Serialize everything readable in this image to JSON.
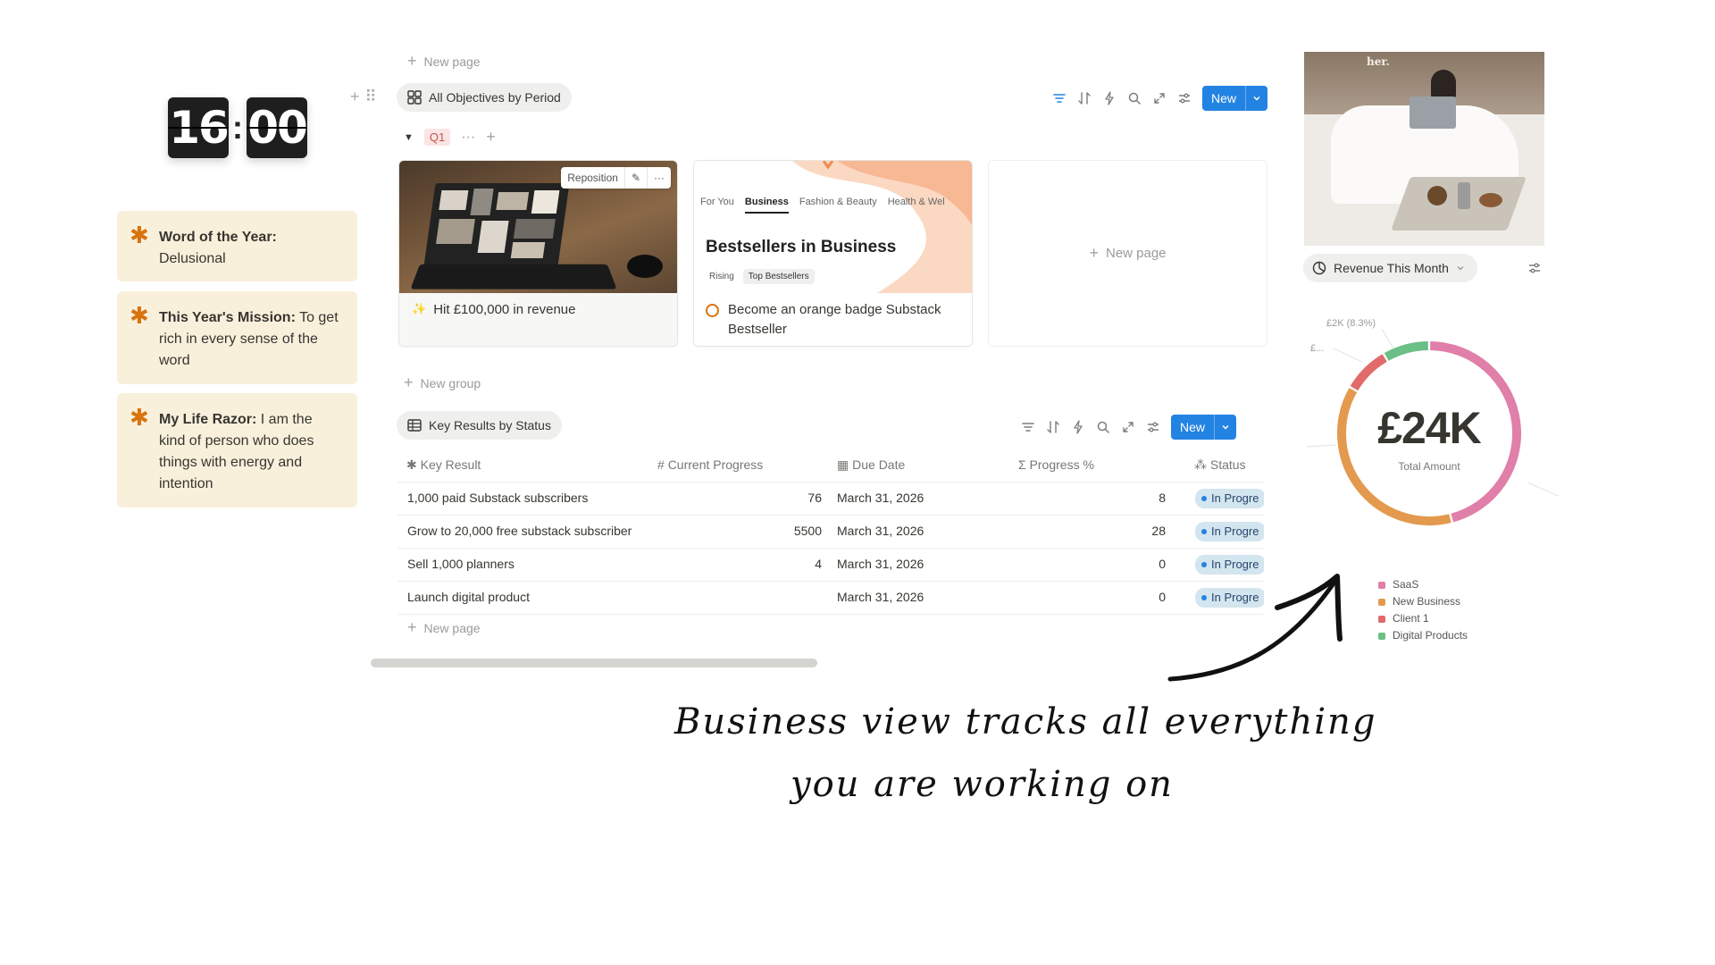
{
  "clock": {
    "hours": "16",
    "minutes": "00",
    "separator": ":"
  },
  "callouts": [
    {
      "bold": "Word of the Year:",
      "text": " Delusional"
    },
    {
      "bold": "This Year's Mission:",
      "text": " To get rich in every sense of the word"
    },
    {
      "bold": "My Life Razor:",
      "text": " I am the kind of person who does things with energy and intention"
    }
  ],
  "objectives": {
    "new_page_top": "New page",
    "view_label": "All Objectives by Period",
    "new_button": "New",
    "group_label": "Q1",
    "cards": [
      {
        "title": "Hit £100,000 in revenue",
        "reposition": "Reposition"
      },
      {
        "title": "Become an orange badge Substack Bestseller",
        "cover_tabs": [
          "For You",
          "Business",
          "Fashion & Beauty",
          "Health & Wel"
        ],
        "cover_heading": "Bestsellers in Business",
        "cover_chips": [
          "Rising",
          "Top Bestsellers"
        ]
      }
    ],
    "new_page_card": "New page",
    "new_group": "New group"
  },
  "key_results": {
    "view_label": "Key Results by Status",
    "new_button": "New",
    "columns": [
      "Key Result",
      "Current Progress",
      "Due Date",
      "Progress %",
      "Status"
    ],
    "rows": [
      {
        "name": "1,000 paid Substack subscribers",
        "progress": "76",
        "due": "March 31, 2026",
        "pct": "8",
        "status": "In Progre"
      },
      {
        "name": "Grow to 20,000 free substack subscriber",
        "progress": "5500",
        "due": "March 31, 2026",
        "pct": "28",
        "status": "In Progre"
      },
      {
        "name": "Sell 1,000 planners",
        "progress": "4",
        "due": "March 31, 2026",
        "pct": "0",
        "status": "In Progre"
      },
      {
        "name": "Launch digital product",
        "progress": "",
        "due": "March 31, 2026",
        "pct": "0",
        "status": "In Progre"
      }
    ],
    "new_page": "New page"
  },
  "photo_caption": "her.",
  "revenue": {
    "view_label": "Revenue This Month",
    "label_top": "£2K (8.3%)",
    "label_left": "£...",
    "total": "£24K",
    "total_label": "Total Amount"
  },
  "chart_data": {
    "type": "pie",
    "donut": true,
    "total_display": "£24K",
    "series": [
      {
        "name": "SaaS",
        "color": "#e07fa9",
        "value": 0.46
      },
      {
        "name": "New Business",
        "color": "#e39a4f",
        "value": 0.375
      },
      {
        "name": "Client 1",
        "color": "#e26a6a",
        "value": 0.083
      },
      {
        "name": "Digital Products",
        "color": "#6cbf86",
        "value": 0.083
      }
    ],
    "legend_placement": "bottom"
  },
  "annotation": {
    "line1": "Business view tracks all everything",
    "line2": "you are working on"
  },
  "colors": {
    "accent": "#2383e2",
    "callout_bg": "#f9f0dc",
    "callout_icon": "#d9730d",
    "status_bg": "#d3e5ef"
  }
}
